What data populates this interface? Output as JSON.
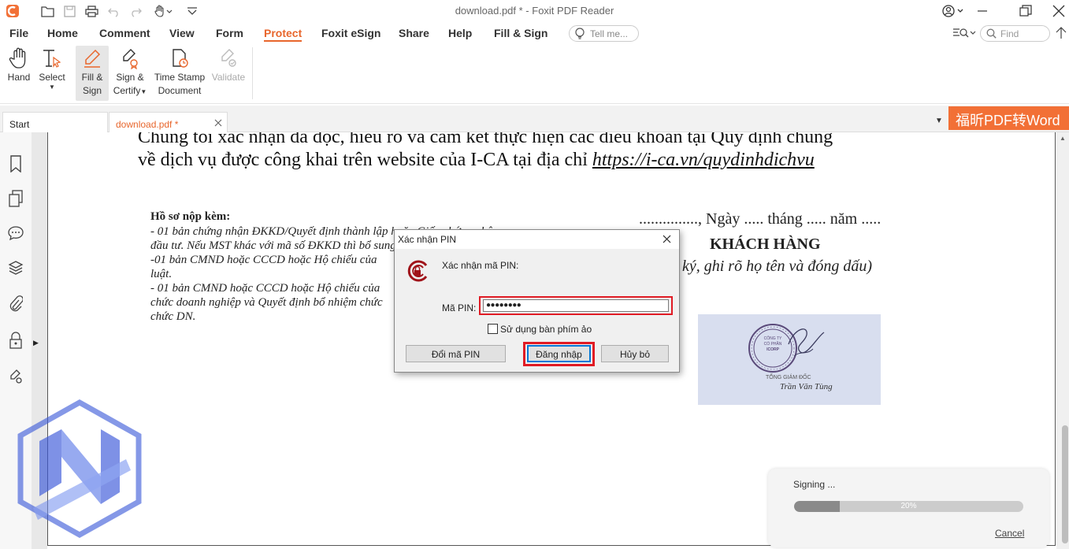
{
  "window": {
    "title": "download.pdf * - Foxit PDF Reader"
  },
  "menu": {
    "items": [
      "File",
      "Home",
      "Comment",
      "View",
      "Form",
      "Protect",
      "Foxit eSign",
      "Share",
      "Help",
      "Fill & Sign"
    ],
    "active": "Protect",
    "tell_me_placeholder": "Tell me...",
    "find_placeholder": "Find"
  },
  "ribbon": {
    "hand": "Hand",
    "select": "Select",
    "fill_sign_1": "Fill &",
    "fill_sign_2": "Sign",
    "sign_certify_1": "Sign &",
    "sign_certify_2": "Certify",
    "time_stamp_1": "Time Stamp",
    "time_stamp_2": "Document",
    "validate": "Validate"
  },
  "tabs": {
    "start": "Start",
    "document": "download.pdf *",
    "ad_banner": "福昕PDF转Word"
  },
  "document": {
    "line1": "Chúng tôi xác nhận đã đọc, hiểu rõ và cam kết thực hiện các điều khoản tại Quy định chung",
    "line2_prefix": "về dịch vụ được công khai trên website của I-CA tại địa chỉ ",
    "line2_link": "https://i-ca.vn/quydinhdichvu",
    "attach_heading": "Hồ sơ nộp kèm:",
    "attach_1": "- 01 bản chứng nhận ĐKKD/Quyết định thành lập hoặc Giấy chứng nhận",
    "attach_2": "đầu tư. Nếu MST khác với mã số ĐKKD thì bổ sung",
    "attach_3": "-01 bản CMND hoặc CCCD hoặc Hộ chiếu của",
    "attach_4": "luật.",
    "attach_5": "- 01 bản CMND hoặc CCCD hoặc Hộ chiếu của",
    "attach_6": "chức doanh nghiệp và Quyết định bổ nhiệm chức",
    "attach_7": "chức DN.",
    "date_line": "..............., Ngày ..... tháng ..... năm .....",
    "customer_heading": "KHÁCH HÀNG",
    "sign_note": "ký, ghi rõ họ tên và đóng dấu)",
    "seal_text_1": "CÔNG TY",
    "seal_text_2": "CỔ PHẦN",
    "seal_text_3": "ICORP",
    "director_title": "TỔNG GIÁM ĐỐC",
    "director_name": "Trần Văn Tùng"
  },
  "dialog": {
    "title": "Xác nhận PIN",
    "prompt": "Xác nhận mã PIN:",
    "pin_label": "Mã PIN:",
    "pin_value": "●●●●●●●●",
    "virtual_keyboard_label": "Sử dụng bàn phím ảo",
    "virtual_keyboard_checked": false,
    "change_pin_button": "Đổi mã PIN",
    "login_button": "Đăng nhập",
    "cancel_button": "Hủy bỏ"
  },
  "signing": {
    "status": "Signing ...",
    "progress": 0.2,
    "progress_label": "20%",
    "cancel": "Cancel"
  },
  "colors": {
    "accent": "#e8662c",
    "highlight": "#e01b24",
    "ad_bg": "#f27036",
    "watermark": "#3d5bd9"
  }
}
